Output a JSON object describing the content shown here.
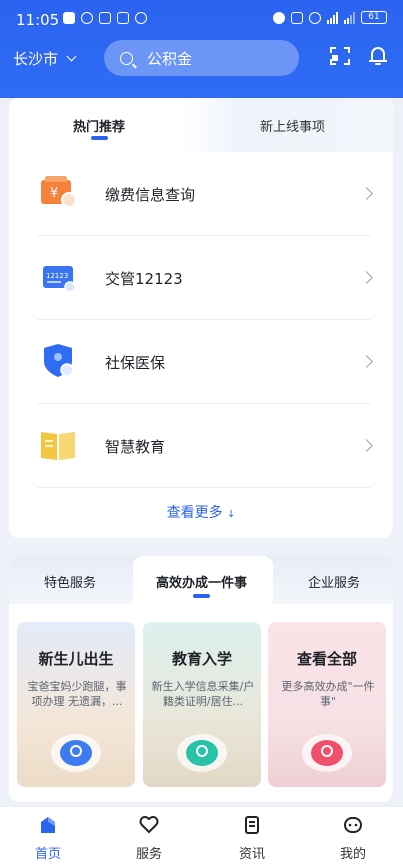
{
  "status_bar": {
    "time": "11:05",
    "battery": "61"
  },
  "header": {
    "city": "长沙市",
    "search_placeholder": "公积金"
  },
  "recommend": {
    "tabs": [
      {
        "label": "热门推荐",
        "active": true
      },
      {
        "label": "新上线事项",
        "active": false
      }
    ],
    "items": [
      {
        "label": "缴费信息查询",
        "icon": "payment-icon"
      },
      {
        "label": "交管12123",
        "icon": "traffic-card-icon"
      },
      {
        "label": "社保医保",
        "icon": "shield-icon"
      },
      {
        "label": "智慧教育",
        "icon": "book-icon"
      }
    ],
    "more_label": "查看更多",
    "icon_texts": {
      "yen": "¥",
      "card": "12123"
    }
  },
  "services": {
    "tabs": [
      {
        "label": "特色服务",
        "active": false
      },
      {
        "label": "高效办成一件事",
        "active": true
      },
      {
        "label": "企业服务",
        "active": false
      }
    ],
    "tiles": [
      {
        "title": "新生儿出生",
        "desc": "宝爸宝妈少跑腿，事项办理 无遗漏，..."
      },
      {
        "title": "教育入学",
        "desc": "新生入学信息采集/户籍类证明/居住..."
      },
      {
        "title": "查看全部",
        "desc": "更多高效办成\"一件事\""
      }
    ]
  },
  "bottom_nav": [
    {
      "label": "首页",
      "active": true
    },
    {
      "label": "服务",
      "active": false
    },
    {
      "label": "资讯",
      "active": false
    },
    {
      "label": "我的",
      "active": false
    }
  ],
  "colors": {
    "primary": "#2a63f0",
    "payment_orange": "#f5813b",
    "book_yellow": "#f4c53f",
    "shield_blue": "#2f6cf4"
  }
}
